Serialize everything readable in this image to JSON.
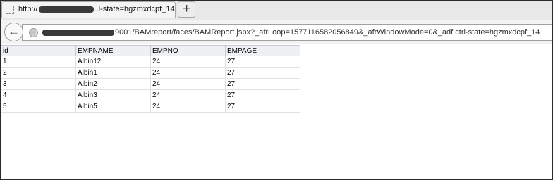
{
  "browser": {
    "tab": {
      "title_prefix": "http://",
      "title_suffix": "..l-state=hgzmxdcpf_14"
    },
    "new_tab_label": "+",
    "back_symbol": "←",
    "url_suffix": "9001/BAMreport/faces/BAMReport.jspx?_afrLoop=1577116582056849&_afrWindowMode=0&_adf.ctrl-state=hgzmxdcpf_14",
    "icons": [
      "page-favicon-icon",
      "back-arrow-icon",
      "globe-icon"
    ]
  },
  "table": {
    "columns": [
      "id",
      "EMPNAME",
      "EMPNO",
      "EMPAGE"
    ],
    "rows": [
      [
        "1",
        "Albin12",
        "24",
        "27"
      ],
      [
        "2",
        "Albin1",
        "24",
        "27"
      ],
      [
        "3",
        "Albin2",
        "24",
        "27"
      ],
      [
        "4",
        "Albin3",
        "24",
        "27"
      ],
      [
        "5",
        "Albin5",
        "24",
        "27"
      ]
    ]
  }
}
